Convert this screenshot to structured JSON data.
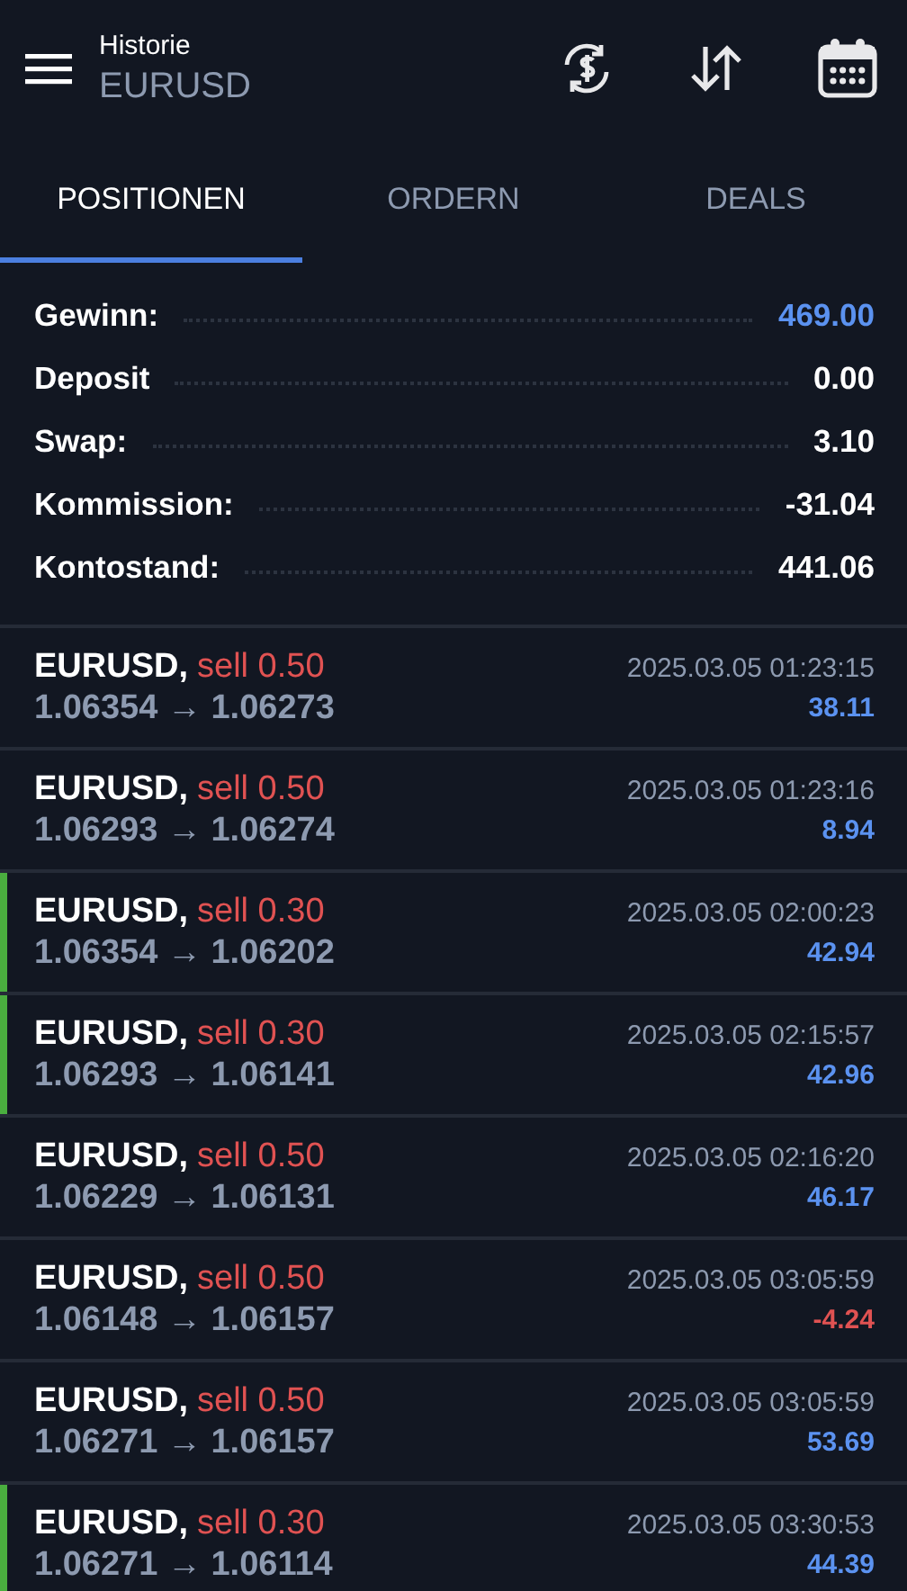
{
  "header": {
    "title": "Historie",
    "subtitle": "EURUSD"
  },
  "tabs": [
    {
      "label": "POSITIONEN",
      "selected": true
    },
    {
      "label": "ORDERN",
      "selected": false
    },
    {
      "label": "DEALS",
      "selected": false
    }
  ],
  "summary": [
    {
      "label": "Gewinn:",
      "value": "469.00",
      "highlight": true
    },
    {
      "label": "Deposit",
      "value": "0.00",
      "highlight": false
    },
    {
      "label": "Swap:",
      "value": "3.10",
      "highlight": false
    },
    {
      "label": "Kommission:",
      "value": "-31.04",
      "highlight": false
    },
    {
      "label": "Kontostand:",
      "value": "441.06",
      "highlight": false
    }
  ],
  "positions": [
    {
      "symbol": "EURUSD,",
      "side": "sell 0.50",
      "prices": "1.06354 → 1.06273",
      "time": "2025.03.05 01:23:15",
      "profit": "38.11",
      "loss": false,
      "flagged": false
    },
    {
      "symbol": "EURUSD,",
      "side": "sell 0.50",
      "prices": "1.06293 → 1.06274",
      "time": "2025.03.05 01:23:16",
      "profit": "8.94",
      "loss": false,
      "flagged": false
    },
    {
      "symbol": "EURUSD,",
      "side": "sell 0.30",
      "prices": "1.06354 → 1.06202",
      "time": "2025.03.05 02:00:23",
      "profit": "42.94",
      "loss": false,
      "flagged": true
    },
    {
      "symbol": "EURUSD,",
      "side": "sell 0.30",
      "prices": "1.06293 → 1.06141",
      "time": "2025.03.05 02:15:57",
      "profit": "42.96",
      "loss": false,
      "flagged": true
    },
    {
      "symbol": "EURUSD,",
      "side": "sell 0.50",
      "prices": "1.06229 → 1.06131",
      "time": "2025.03.05 02:16:20",
      "profit": "46.17",
      "loss": false,
      "flagged": false
    },
    {
      "symbol": "EURUSD,",
      "side": "sell 0.50",
      "prices": "1.06148 → 1.06157",
      "time": "2025.03.05 03:05:59",
      "profit": "-4.24",
      "loss": true,
      "flagged": false
    },
    {
      "symbol": "EURUSD,",
      "side": "sell 0.50",
      "prices": "1.06271 → 1.06157",
      "time": "2025.03.05 03:05:59",
      "profit": "53.69",
      "loss": false,
      "flagged": false
    },
    {
      "symbol": "EURUSD,",
      "side": "sell 0.30",
      "prices": "1.06271 → 1.06114",
      "time": "2025.03.05 03:30:53",
      "profit": "44.39",
      "loss": false,
      "flagged": true
    }
  ]
}
